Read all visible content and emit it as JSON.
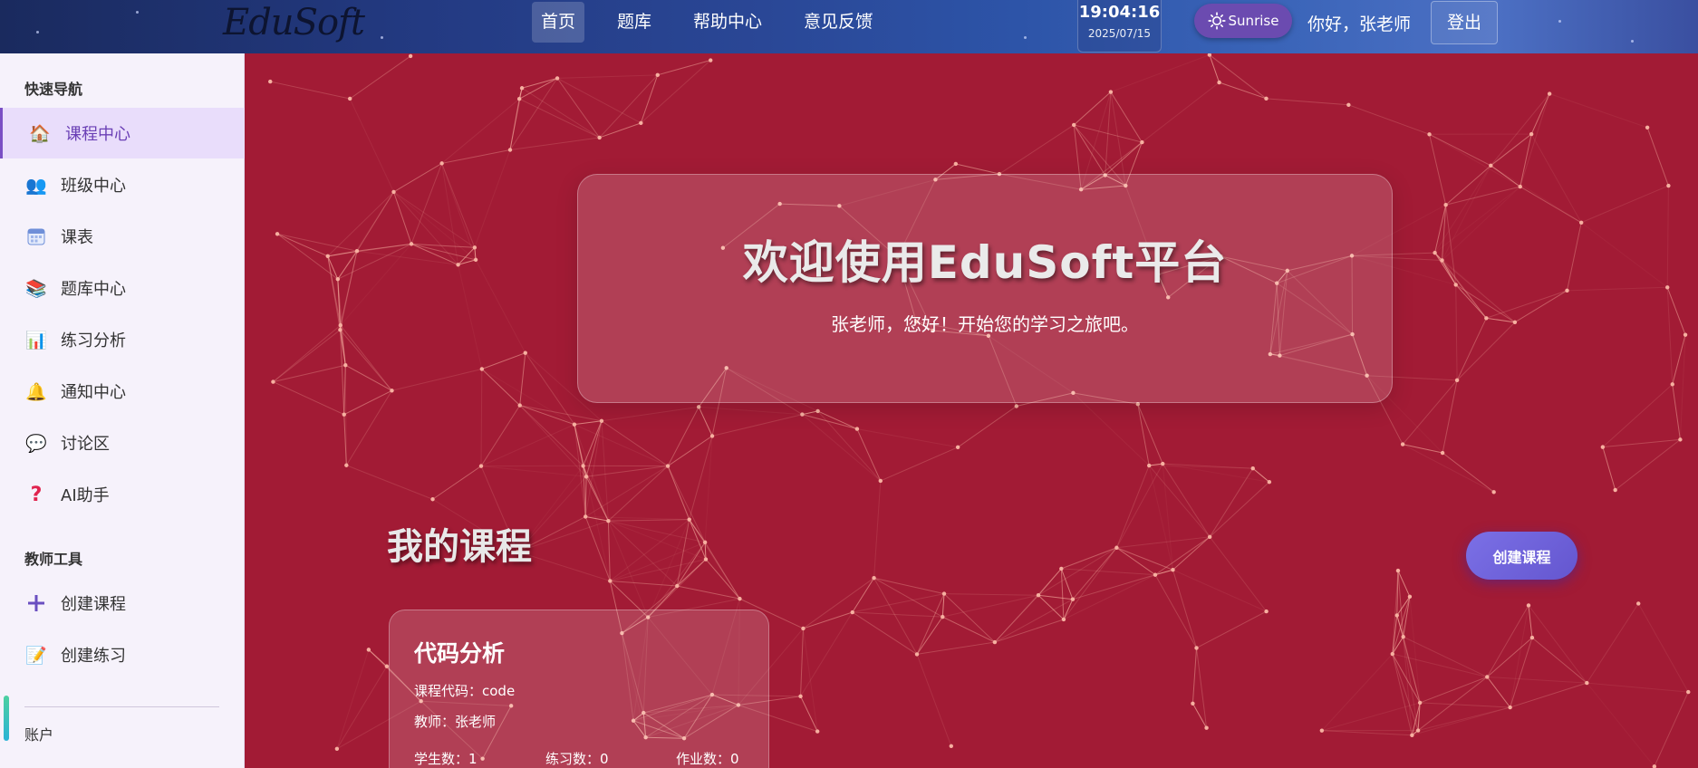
{
  "header": {
    "logo": "EduSoft",
    "nav": [
      "首页",
      "题库",
      "帮助中心",
      "意见反馈"
    ],
    "clock": {
      "time": "19:04:16",
      "date": "2025/07/15"
    },
    "theme_label": "Sunrise",
    "greeting": "你好，张老师",
    "logout_label": "登出"
  },
  "sidebar": {
    "quick_nav_title": "快速导航",
    "items": [
      {
        "label": "课程中心",
        "icon": "house-icon"
      },
      {
        "label": "班级中心",
        "icon": "users-icon"
      },
      {
        "label": "课表",
        "icon": "calendar-icon"
      },
      {
        "label": "题库中心",
        "icon": "books-icon"
      },
      {
        "label": "练习分析",
        "icon": "bar-chart-icon"
      },
      {
        "label": "通知中心",
        "icon": "bell-icon"
      },
      {
        "label": "讨论区",
        "icon": "speech-bubble-icon"
      },
      {
        "label": "AI助手",
        "icon": "question-icon"
      }
    ],
    "teacher_tools_title": "教师工具",
    "tools": [
      {
        "label": "创建课程",
        "icon": "plus-icon"
      },
      {
        "label": "创建练习",
        "icon": "edit-icon"
      }
    ],
    "account_title": "账户"
  },
  "main": {
    "welcome_title": "欢迎使用EduSoft平台",
    "welcome_subtitle": "张老师，您好！开始您的学习之旅吧。",
    "section_title": "我的课程",
    "create_button": "创建课程",
    "course": {
      "name": "代码分析",
      "code_line": "课程代码：code",
      "teacher_line": "教师：张老师",
      "students": "学生数：1",
      "exercises": "练习数：0",
      "assignments": "作业数：0"
    }
  },
  "colors": {
    "accent": "#6a3fb5",
    "background": "#a21b35",
    "network_line": "#f6b0a0"
  }
}
